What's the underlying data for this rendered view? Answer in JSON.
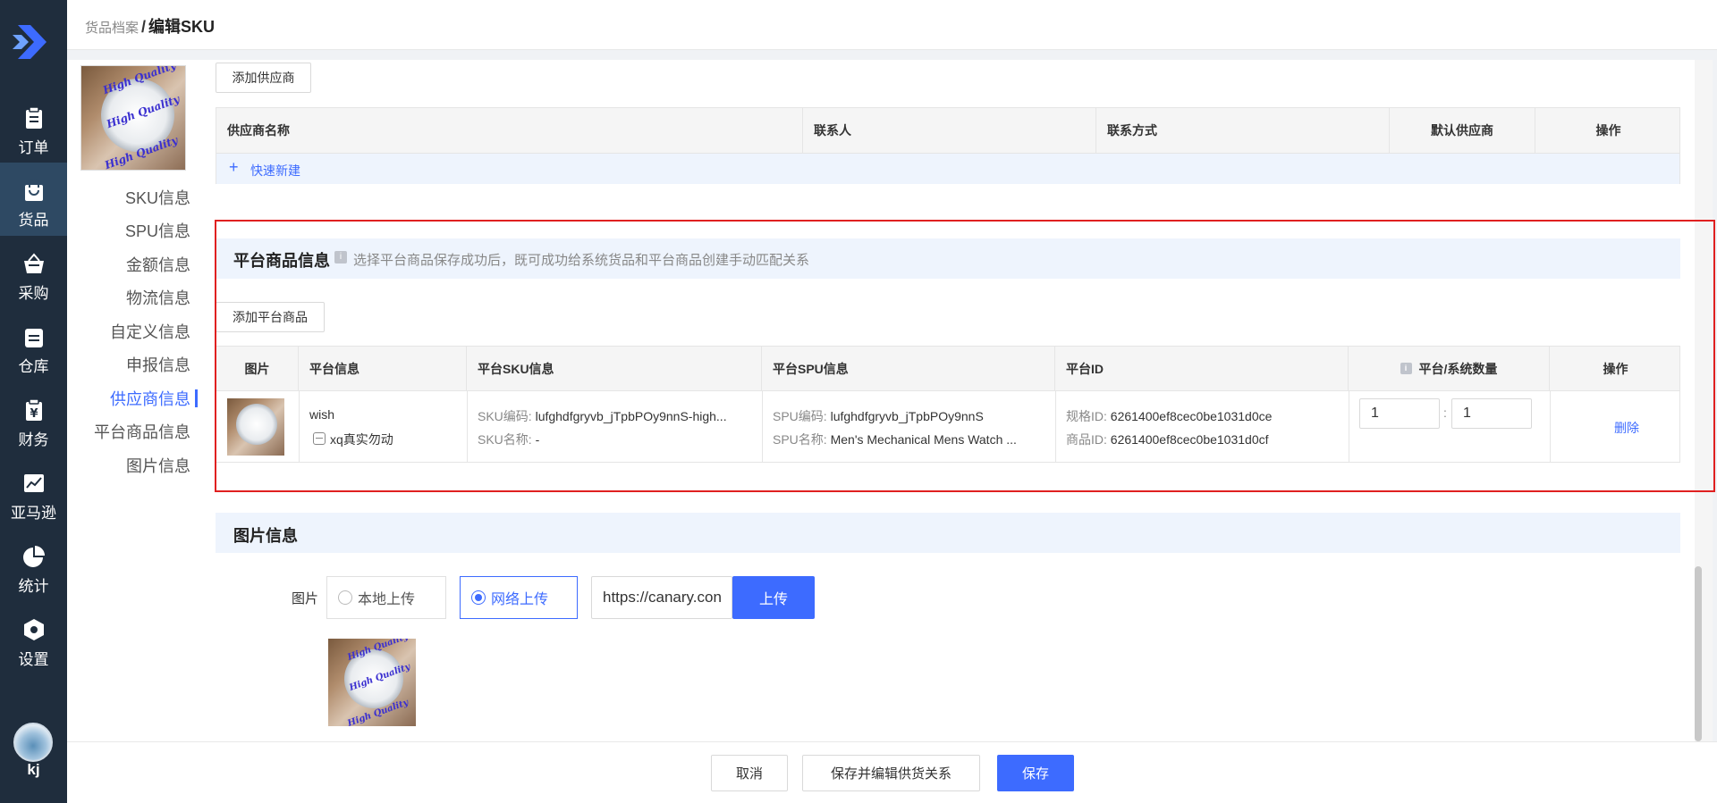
{
  "nav": {
    "items": [
      {
        "label": "订单",
        "icon": "clipboard-icon"
      },
      {
        "label": "货品",
        "icon": "shopping-bag-icon"
      },
      {
        "label": "采购",
        "icon": "basket-icon"
      },
      {
        "label": "仓库",
        "icon": "warehouse-icon"
      },
      {
        "label": "财务",
        "icon": "yuan-clipboard-icon"
      },
      {
        "label": "亚马逊",
        "icon": "trend-chart-icon"
      },
      {
        "label": "统计",
        "icon": "pie-chart-icon"
      },
      {
        "label": "设置",
        "icon": "gear-hexagon-icon"
      }
    ],
    "active": "货品",
    "user": "kj"
  },
  "header": {
    "crumb_parent": "货品档案",
    "crumb_sep": "/",
    "crumb_current": "编辑SKU"
  },
  "anchors": [
    "SKU信息",
    "SPU信息",
    "金额信息",
    "物流信息",
    "自定义信息",
    "申报信息",
    "供应商信息",
    "平台商品信息",
    "图片信息"
  ],
  "anchor_active": "供应商信息",
  "thumb_watermark": "High Quality",
  "supplier": {
    "add_button": "添加供应商",
    "columns": [
      "供应商名称",
      "联系人",
      "联系方式",
      "默认供应商",
      "操作"
    ],
    "quick_add": "快速新建",
    "quick_add_icon": "+"
  },
  "platform": {
    "title": "平台商品信息",
    "info_icon": "i",
    "hint": "选择平台商品保存成功后，既可成功给系统货品和平台商品创建手动匹配关系",
    "add_button": "添加平台商品",
    "columns": [
      "图片",
      "平台信息",
      "平台SKU信息",
      "平台SPU信息",
      "平台ID",
      "平台/系统数量",
      "操作"
    ],
    "row": {
      "platform": "wish",
      "shop": "xq真实勿动",
      "sku_code_label": "SKU编码:",
      "sku_code": "lufghdfgryvb_jTpbPOy9nnS-high...",
      "sku_name_label": "SKU名称:",
      "sku_name": "-",
      "spu_code_label": "SPU编码:",
      "spu_code": "lufghdfgryvb_jTpbPOy9nnS",
      "spu_name_label": "SPU名称:",
      "spu_name": "Men's Mechanical Mens Watch ...",
      "spec_id_label": "规格ID:",
      "spec_id": "6261400ef8cec0be1031d0ce",
      "product_id_label": "商品ID:",
      "product_id": "6261400ef8cec0be1031d0cf",
      "platform_qty": "1",
      "qty_sep": ":",
      "system_qty": "1",
      "delete": "删除"
    }
  },
  "images": {
    "title": "图片信息",
    "field_label": "图片",
    "local_upload": "本地上传",
    "network_upload": "网络上传",
    "url_value": "https://canary.con",
    "upload_button": "上传"
  },
  "footer": {
    "cancel": "取消",
    "save_edit": "保存并编辑供货关系",
    "save": "保存"
  },
  "colors": {
    "primary": "#3d6bff",
    "nav_bg": "#1f2d3d",
    "highlight": "#e02020"
  }
}
